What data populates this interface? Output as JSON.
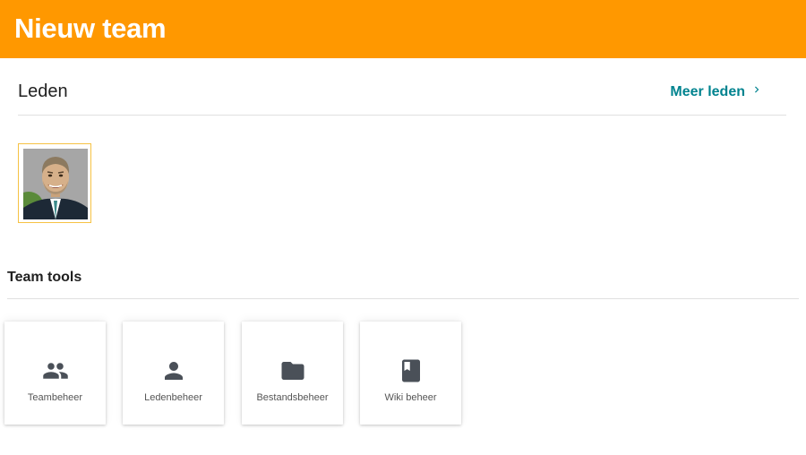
{
  "header": {
    "title": "Nieuw team",
    "background_color": "#ff9800"
  },
  "members": {
    "title": "Leden",
    "more_link_label": "Meer leden",
    "more_link_icon": "chevron-right-icon",
    "link_color": "#00838f",
    "avatars": [
      {
        "icon": "member-avatar",
        "border_color": "#f6c244"
      }
    ]
  },
  "tools": {
    "title": "Team tools",
    "items": [
      {
        "label": "Teambeheer",
        "icon": "group-icon"
      },
      {
        "label": "Ledenbeheer",
        "icon": "person-icon"
      },
      {
        "label": "Bestandsbeheer",
        "icon": "folder-icon"
      },
      {
        "label": "Wiki beheer",
        "icon": "book-icon"
      }
    ],
    "icon_color": "#4a5058"
  }
}
